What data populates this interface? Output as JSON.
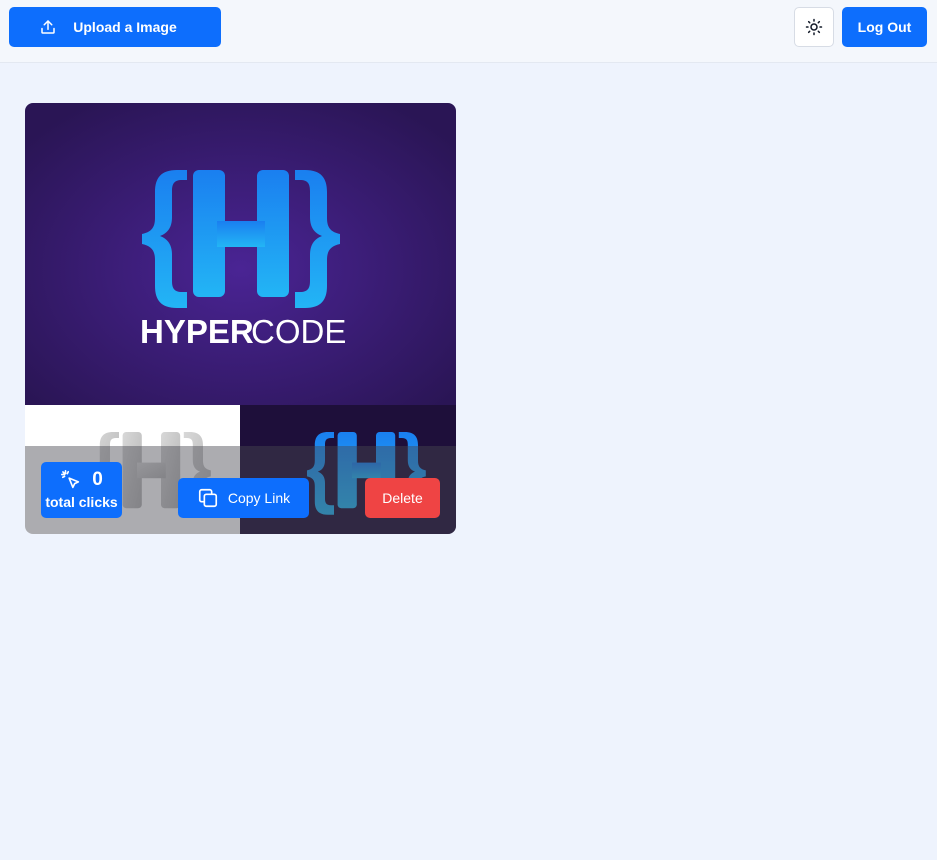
{
  "header": {
    "upload_label": "Upload a Image",
    "logout_label": "Log Out",
    "upload_icon": "upload-icon",
    "theme_icon": "sun-icon"
  },
  "card": {
    "image": {
      "brand_bold": "HYPER",
      "brand_light": "CODE"
    },
    "clicks": {
      "count": "0",
      "label": "total clicks",
      "icon": "cursor-click-icon"
    },
    "copy_label": "Copy Link",
    "copy_icon": "copy-icon",
    "delete_label": "Delete"
  },
  "colors": {
    "primary": "#0d6efd",
    "danger": "#ef4444",
    "page_bg": "#eef3fd",
    "logo_purple": "#3a1a6e",
    "logo_blue": "#1a9cf0"
  }
}
